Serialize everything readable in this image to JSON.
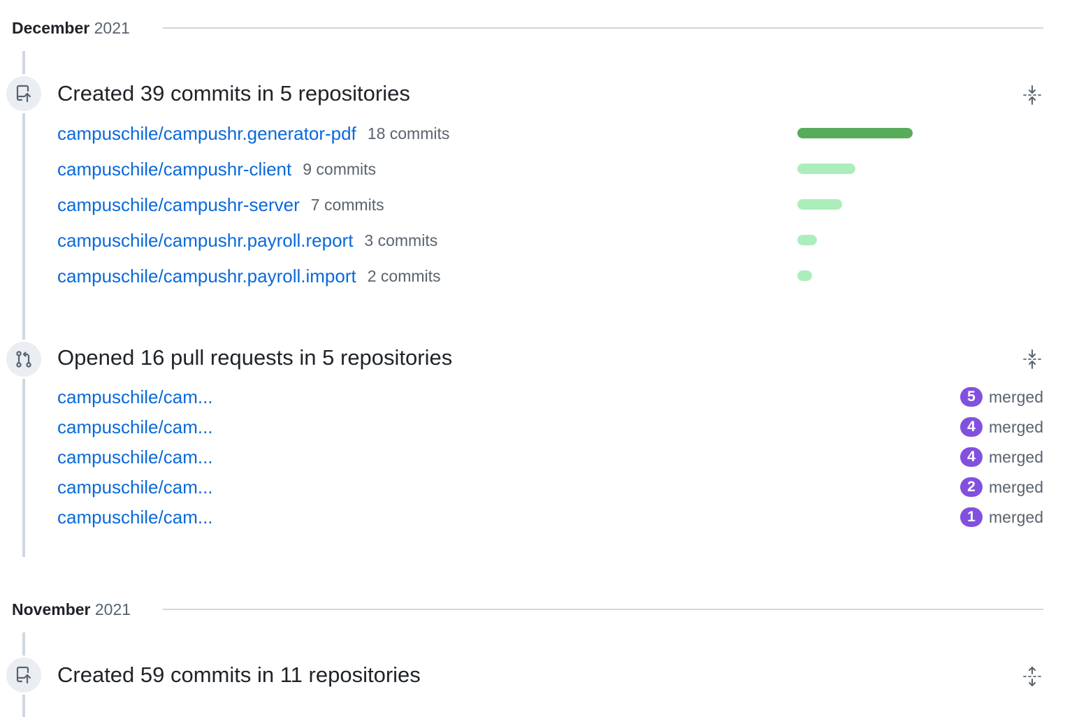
{
  "months": [
    {
      "name": "December",
      "year": "2021"
    },
    {
      "name": "November",
      "year": "2021"
    }
  ],
  "commits_event": {
    "title": "Created 39 commits in 5 repositories",
    "icon": "repo-push-icon",
    "repos": [
      {
        "name": "campuschile/campushr.generator-pdf",
        "count_label": "18 commits",
        "commits": 18
      },
      {
        "name": "campuschile/campushr-client",
        "count_label": "9 commits",
        "commits": 9
      },
      {
        "name": "campuschile/campushr-server",
        "count_label": "7 commits",
        "commits": 7
      },
      {
        "name": "campuschile/campushr.payroll.report",
        "count_label": "3 commits",
        "commits": 3
      },
      {
        "name": "campuschile/campushr.payroll.import",
        "count_label": "2 commits",
        "commits": 2
      }
    ],
    "bar_colors": {
      "top": "#57ab5a",
      "rest": "#aceebb"
    }
  },
  "pr_event": {
    "title": "Opened 16 pull requests in 5 repositories",
    "icon": "git-pull-request-icon",
    "repos": [
      {
        "name": "campuschile/cam...",
        "count": "5",
        "status": "merged"
      },
      {
        "name": "campuschile/cam...",
        "count": "4",
        "status": "merged"
      },
      {
        "name": "campuschile/cam...",
        "count": "4",
        "status": "merged"
      },
      {
        "name": "campuschile/cam...",
        "count": "2",
        "status": "merged"
      },
      {
        "name": "campuschile/cam...",
        "count": "1",
        "status": "merged"
      }
    ],
    "badge_color": "#8250df"
  },
  "november_event": {
    "title": "Created 59 commits in 11 repositories",
    "icon": "repo-push-icon"
  },
  "icons": {
    "collapse": "fold-icon",
    "expand": "unfold-icon"
  },
  "colors": {
    "link": "#0969da",
    "muted": "#59636e",
    "line": "#d0d7de"
  }
}
